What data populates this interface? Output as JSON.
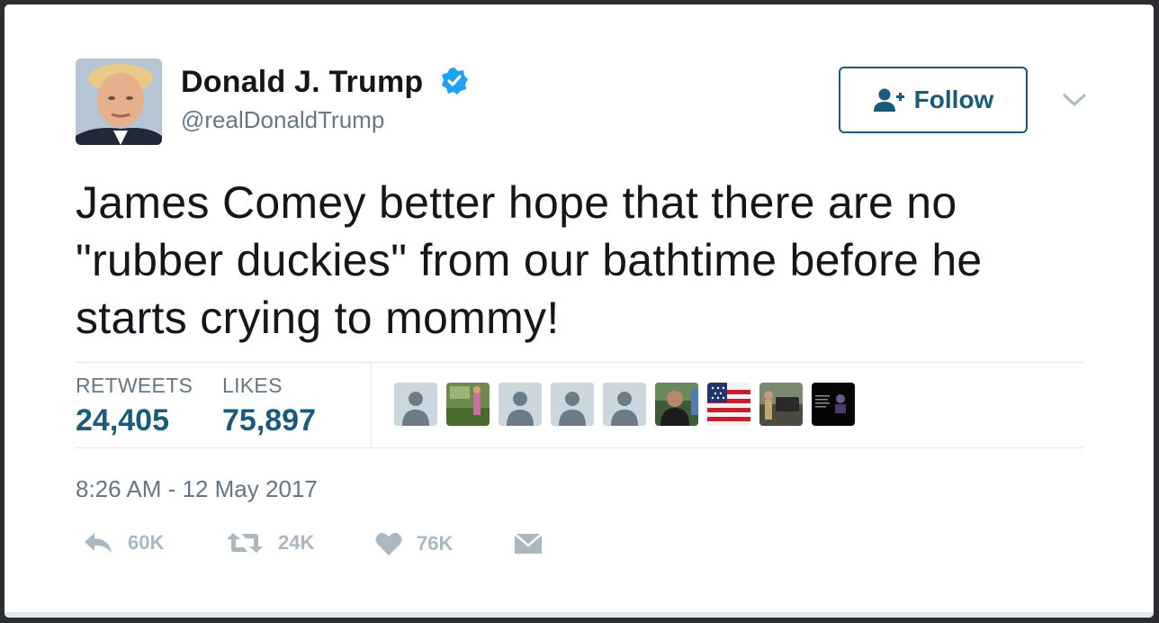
{
  "user": {
    "name": "Donald J. Trump",
    "handle": "@realDonaldTrump"
  },
  "follow_button": {
    "label": "Follow"
  },
  "tweet": {
    "lines": [
      "James Comey better hope that there are no",
      "\"rubber duckies\" from our bathtime before he",
      "starts crying to mommy!"
    ]
  },
  "stats": {
    "retweets_label": "RETWEETS",
    "retweets_value": "24,405",
    "likes_label": "LIKES",
    "likes_value": "75,897"
  },
  "likers": [
    {
      "type": "default"
    },
    {
      "type": "photo"
    },
    {
      "type": "default"
    },
    {
      "type": "default"
    },
    {
      "type": "default"
    },
    {
      "type": "photo"
    },
    {
      "type": "photo"
    },
    {
      "type": "photo"
    },
    {
      "type": "photo"
    }
  ],
  "timestamp": "8:26 AM - 12 May 2017",
  "actions": {
    "reply_count": "60K",
    "retweet_count": "24K",
    "like_count": "76K"
  },
  "colors": {
    "accent": "#1b5a7a",
    "verified": "#1da1f2",
    "muted": "#657786",
    "action": "#aab8c2"
  }
}
